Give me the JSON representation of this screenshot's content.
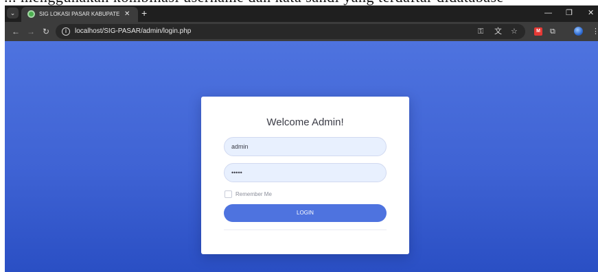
{
  "caption": {
    "text": "... menggunakan kombinasi username dan kata sandi yang terdaftar didatabase"
  },
  "browser": {
    "tab": {
      "title": "SIG LOKASI PASAR KABUPATEN",
      "close_glyph": "✕"
    },
    "tab_menu_glyph": "⌄",
    "new_tab_glyph": "+",
    "window_controls": {
      "minimize": "—",
      "restore": "❐",
      "close": "✕"
    },
    "nav": {
      "back": "←",
      "forward": "→",
      "reload": "↻"
    },
    "address": {
      "url": "localhost/SIG-PASAR/admin/login.php"
    },
    "icons": {
      "password_key": "⚿",
      "translate": "文",
      "bookmark_star": "☆",
      "extension_badge": "M",
      "extensions_puzzle": "⧉",
      "menu_more": "⋮"
    }
  },
  "login": {
    "title": "Welcome Admin!",
    "username_value": "admin",
    "password_value": "•••••",
    "remember_label": "Remember Me",
    "remember_checked": false,
    "submit_label": "LOGIN"
  },
  "colors": {
    "background_top": "#4e73df",
    "background_bottom": "#2a4fc4",
    "primary_button": "#4e73df",
    "input_fill": "#e8f0fe"
  }
}
